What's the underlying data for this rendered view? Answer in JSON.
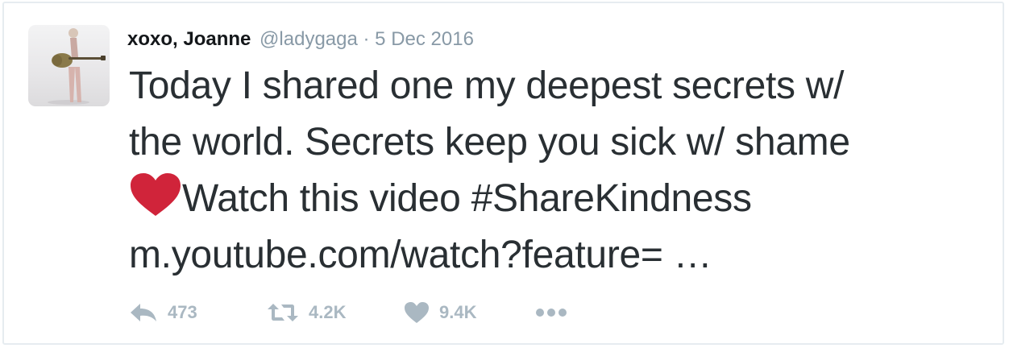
{
  "tweet": {
    "display_name": "xoxo, Joanne",
    "handle": "@ladygaga",
    "separator": "·",
    "date": "5 Dec 2016",
    "text": {
      "line1": "Today I shared one my deepest secrets w/",
      "line2": "the world. Secrets keep you sick w/ shame",
      "line3_text": "Watch this video ",
      "hashtag": "#ShareKindness",
      "link": "m.youtube.com/watch?feature= …"
    },
    "emoji": "red-heart-emoji",
    "actions": {
      "reply_count": "473",
      "retweet_count": "4.2K",
      "like_count": "9.4K"
    }
  },
  "icons": {
    "reply": "reply-icon",
    "retweet": "retweet-icon",
    "like": "heart-icon",
    "more": "more-dots-icon"
  },
  "colors": {
    "text": "#292f33",
    "name": "#14171a",
    "muted": "#8899a6",
    "action": "#aab8c2",
    "heart_emoji": "#d0243a",
    "border": "#e6ecf0"
  }
}
